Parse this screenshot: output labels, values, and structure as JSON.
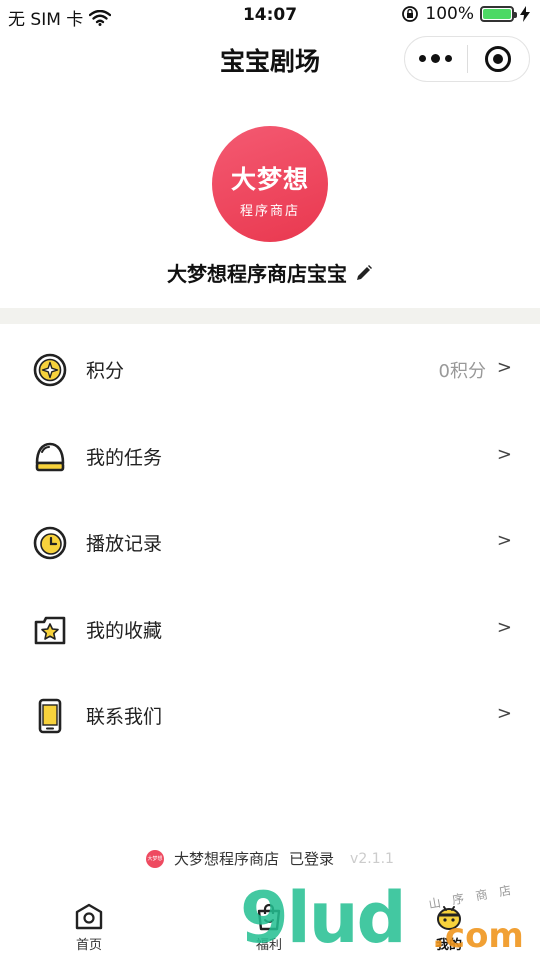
{
  "status_bar": {
    "carrier": "无 SIM 卡",
    "time": "14:07",
    "battery": "100%"
  },
  "nav": {
    "title": "宝宝剧场"
  },
  "profile": {
    "avatar_line1": "大梦想",
    "avatar_line2": "程序商店",
    "name": "大梦想程序商店宝宝"
  },
  "menu": {
    "items": [
      {
        "label": "积分",
        "value": "0积分",
        "arrow": ">",
        "icon": "points-icon"
      },
      {
        "label": "我的任务",
        "value": "",
        "arrow": ">",
        "icon": "task-icon"
      },
      {
        "label": "播放记录",
        "value": "",
        "arrow": ">",
        "icon": "clock-icon"
      },
      {
        "label": "我的收藏",
        "value": "",
        "arrow": ">",
        "icon": "star-icon"
      },
      {
        "label": "联系我们",
        "value": "",
        "arrow": ">",
        "icon": "phone-icon"
      }
    ]
  },
  "footer": {
    "store_name": "大梦想程序商店",
    "login_status": "已登录",
    "version": "v2.1.1",
    "mini_logo_text": "大梦想"
  },
  "tabs": [
    {
      "label": "首页"
    },
    {
      "label": "福利"
    },
    {
      "label": "我的"
    }
  ],
  "watermark": {
    "main": "9lud",
    "com": ".com",
    "cn": "山 序 商 店"
  },
  "colors": {
    "accent_red": "#ee4a60",
    "icon_yellow": "#f7d23c",
    "separator": "#f2f2ee"
  }
}
